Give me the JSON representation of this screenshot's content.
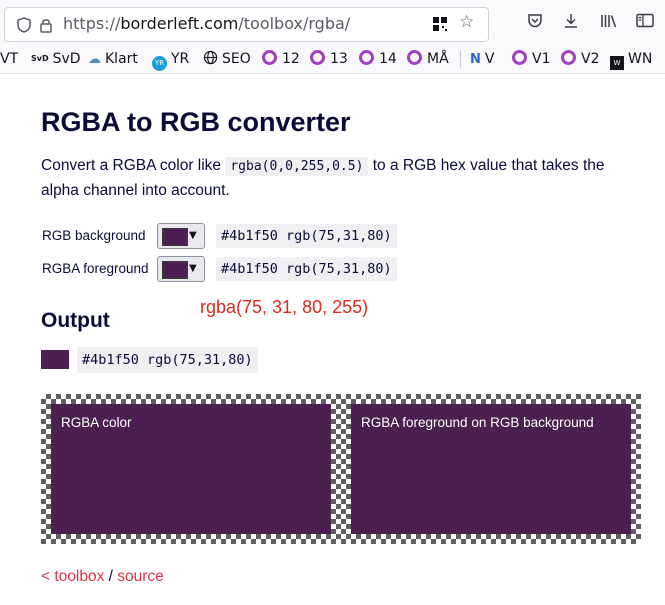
{
  "browser": {
    "url_prefix": "https://",
    "url_domain": "borderleft.com",
    "url_path": "/toolbox/rgba/",
    "icons": {
      "shield": "shield-icon",
      "lock": "lock-icon",
      "qr": "qr-code-icon",
      "bookmark_star": "star-icon",
      "pocket": "pocket-icon",
      "downloads": "download-icon",
      "library": "library-icon",
      "sidebar": "sidebar-icon"
    }
  },
  "bookmarks": [
    {
      "label": "VT",
      "icon": "none"
    },
    {
      "label": "SvD",
      "icon": "svd-logo-icon"
    },
    {
      "label": "Klart",
      "icon": "cloud-icon"
    },
    {
      "label": "YR",
      "icon": "yr-logo-icon"
    },
    {
      "label": "SEO",
      "icon": "globe-icon"
    },
    {
      "label": "12",
      "icon": "ring-icon"
    },
    {
      "label": "13",
      "icon": "ring-icon"
    },
    {
      "label": "14",
      "icon": "ring-icon"
    },
    {
      "label": "MÅ",
      "icon": "ring-icon"
    },
    {
      "label": "V",
      "icon": "notion-logo-icon"
    },
    {
      "label": "V1",
      "icon": "ring-icon"
    },
    {
      "label": "V2",
      "icon": "ring-icon"
    },
    {
      "label": "WN",
      "icon": "wn-logo-icon"
    }
  ],
  "page": {
    "title": "RGBA to RGB converter",
    "intro_before": "Convert a RGBA color like ",
    "intro_code": "rgba(0,0,255,0.5)",
    "intro_after": " to a RGB hex value that takes the alpha channel into account.",
    "rgb_background": {
      "label": "RGB background",
      "value_text": "#4b1f50 rgb(75,31,80)",
      "swatch_color": "#4b1f50"
    },
    "rgba_foreground": {
      "label": "RGBA foreground",
      "value_text": "#4b1f50 rgb(75,31,80)",
      "swatch_color": "#4b1f50"
    },
    "rgba_readout": "rgba(75, 31, 80, 255)",
    "output": {
      "heading": "Output",
      "value_text": "#4b1f50 rgb(75,31,80)",
      "swatch_color": "#4b1f50"
    },
    "preview": {
      "left_label": "RGBA color",
      "right_label": "RGBA foreground on RGB background",
      "fill_color": "#4b1f50"
    },
    "footer": {
      "toolbox_link": "< toolbox",
      "separator": " / ",
      "source_link": "source"
    }
  },
  "colors": {
    "accent_red": "#e0281e",
    "link_red": "#e0334a",
    "text_navy": "#0b0b3a",
    "swatch": "#4b1f50"
  }
}
